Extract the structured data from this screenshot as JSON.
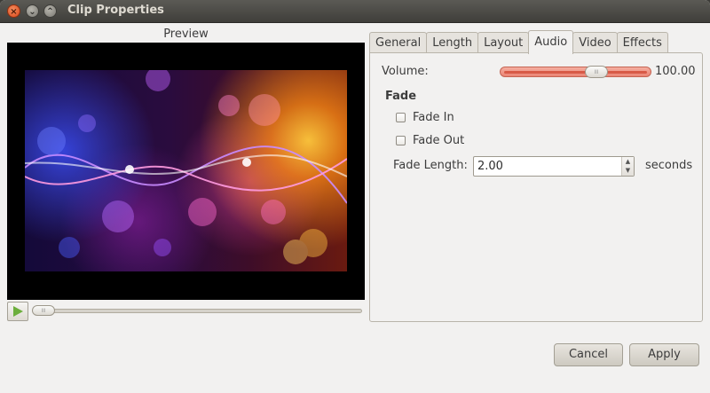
{
  "window": {
    "title": "Clip Properties",
    "controls": {
      "close": "×",
      "minimize": "⌄",
      "maximize": "⌃"
    }
  },
  "preview": {
    "label": "Preview",
    "play_icon": "play-icon",
    "seek_position_fraction": 0.0
  },
  "tabs": [
    {
      "label": "General",
      "active": false
    },
    {
      "label": "Length",
      "active": false
    },
    {
      "label": "Layout",
      "active": false
    },
    {
      "label": "Audio",
      "active": true
    },
    {
      "label": "Video",
      "active": false
    },
    {
      "label": "Effects",
      "active": false
    }
  ],
  "audio": {
    "volume_label": "Volume:",
    "volume_value": "100.00",
    "fade_heading": "Fade",
    "fade_in_label": "Fade In",
    "fade_in_checked": false,
    "fade_out_label": "Fade Out",
    "fade_out_checked": false,
    "fade_length_label": "Fade Length:",
    "fade_length_value": "2.00",
    "fade_length_unit": "seconds"
  },
  "buttons": {
    "cancel": "Cancel",
    "apply": "Apply"
  },
  "colors": {
    "titlebar": "#3f3e3a",
    "window_bg": "#f2f1f0",
    "volume_track": "#eb8474",
    "close_button": "#d9481c",
    "play_icon": "#6cae3c"
  }
}
